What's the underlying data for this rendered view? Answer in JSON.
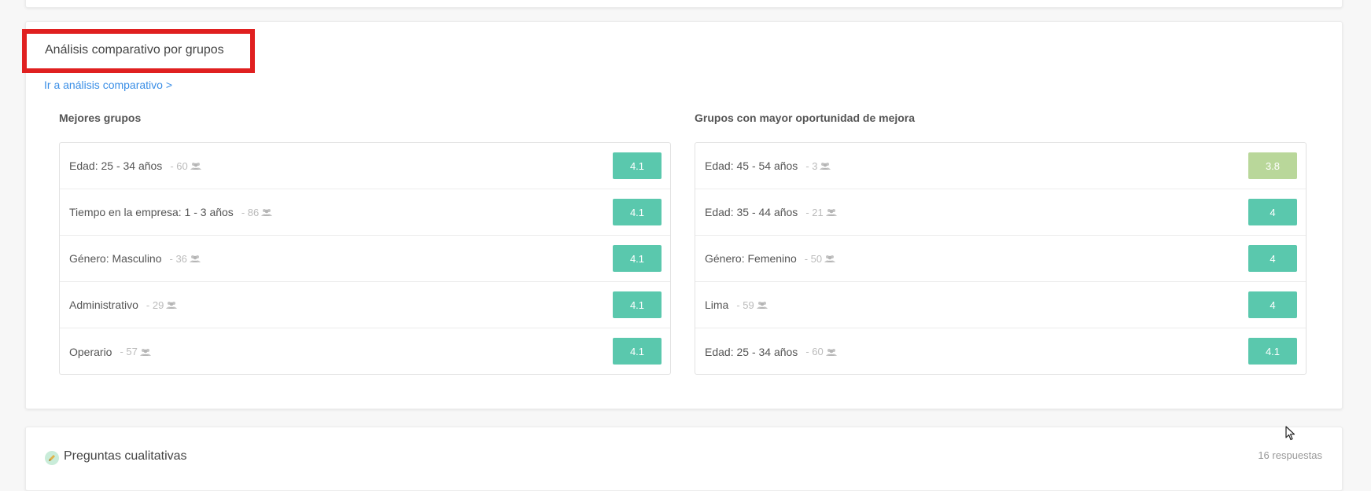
{
  "section": {
    "title": "Análisis comparativo por grupos",
    "link": "Ir a análisis comparativo >"
  },
  "best_groups": {
    "title": "Mejores grupos",
    "rows": [
      {
        "label": "Edad: 25 - 34 años",
        "count": "- 60",
        "score": "4.1",
        "color": "#5ac8ad"
      },
      {
        "label": "Tiempo en la empresa: 1 - 3 años",
        "count": "- 86",
        "score": "4.1",
        "color": "#5ac8ad"
      },
      {
        "label": "Género: Masculino",
        "count": "- 36",
        "score": "4.1",
        "color": "#5ac8ad"
      },
      {
        "label": "Administrativo",
        "count": "- 29",
        "score": "4.1",
        "color": "#5ac8ad"
      },
      {
        "label": "Operario",
        "count": "- 57",
        "score": "4.1",
        "color": "#5ac8ad"
      }
    ]
  },
  "improve_groups": {
    "title": "Grupos con mayor oportunidad de mejora",
    "rows": [
      {
        "label": "Edad: 45 - 54 años",
        "count": "- 3",
        "score": "3.8",
        "color": "#b9d79a"
      },
      {
        "label": "Edad: 35 - 44 años",
        "count": "- 21",
        "score": "4",
        "color": "#5ac8ad"
      },
      {
        "label": "Género: Femenino",
        "count": "- 50",
        "score": "4",
        "color": "#5ac8ad"
      },
      {
        "label": "Lima",
        "count": "- 59",
        "score": "4",
        "color": "#5ac8ad"
      },
      {
        "label": "Edad: 25 - 34 años",
        "count": "- 60",
        "score": "4.1",
        "color": "#5ac8ad"
      }
    ]
  },
  "qualitative": {
    "title": "Preguntas cualitativas",
    "responses": "16 respuestas",
    "icon": "pencil-icon"
  },
  "colors": {
    "accent_link": "#3a8ee6",
    "highlight": "#e02020"
  }
}
